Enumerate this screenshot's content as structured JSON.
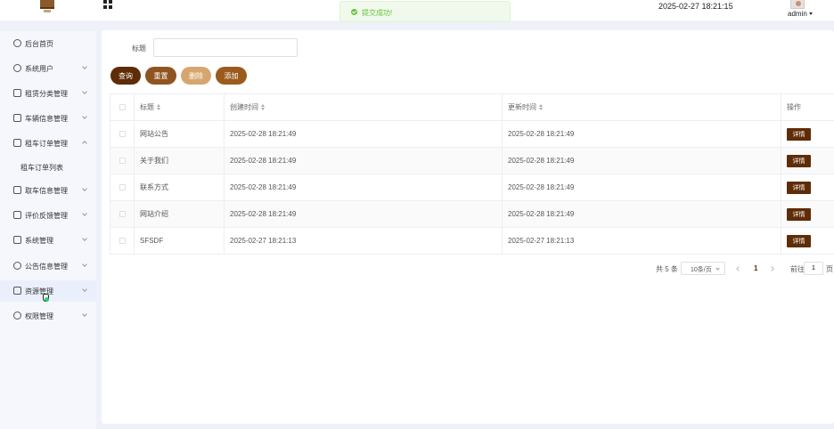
{
  "header": {
    "datetime": "2025-02-27 18:21:15",
    "username": "admin"
  },
  "toast": {
    "message": "提交成功!"
  },
  "sidebar": {
    "items": [
      {
        "label": "后台首页",
        "icon": "clock-icon"
      },
      {
        "label": "系统用户",
        "icon": "user-icon"
      },
      {
        "label": "租赁分类管理",
        "icon": "card-icon"
      },
      {
        "label": "车辆信息管理",
        "icon": "card-icon"
      },
      {
        "label": "租车订单管理",
        "icon": "card-icon"
      },
      {
        "label": "租车订单列表"
      },
      {
        "label": "取车信息管理",
        "icon": "card-icon"
      },
      {
        "label": "评价反馈管理",
        "icon": "card-icon"
      },
      {
        "label": "系统管理",
        "icon": "folder-icon"
      },
      {
        "label": "公告信息管理",
        "icon": "bell-icon"
      },
      {
        "label": "资源管理",
        "icon": "box-icon"
      },
      {
        "label": "权限管理",
        "icon": "user-icon"
      }
    ]
  },
  "search": {
    "label": "标题",
    "value": "",
    "placeholder": ""
  },
  "buttons": {
    "query": "查询",
    "reset": "重置",
    "delete": "删除",
    "add": "添加"
  },
  "table": {
    "headers": {
      "title": "标题",
      "created": "创建时间",
      "updated": "更新时间",
      "action": "操作"
    },
    "rows": [
      {
        "title": "网站公告",
        "created": "2025-02-28 18:21:49",
        "updated": "2025-02-28 18:21:49",
        "action": "详情"
      },
      {
        "title": "关于我们",
        "created": "2025-02-28 18:21:49",
        "updated": "2025-02-28 18:21:49",
        "action": "详情"
      },
      {
        "title": "联系方式",
        "created": "2025-02-28 18:21:49",
        "updated": "2025-02-28 18:21:49",
        "action": "详情"
      },
      {
        "title": "网站介绍",
        "created": "2025-02-28 18:21:49",
        "updated": "2025-02-28 18:21:49",
        "action": "详情"
      },
      {
        "title": "SFSDF",
        "created": "2025-02-27 18:21:13",
        "updated": "2025-02-27 18:21:13",
        "action": "详情"
      }
    ]
  },
  "pagination": {
    "total": "共 5 条",
    "page_size": "10条/页",
    "current_page": "1",
    "goto_label": "前往",
    "goto_value": "1",
    "page_suffix": "页"
  },
  "colors": {
    "primary": "#5e2c06",
    "reset": "#8f5520",
    "delete": "#d7a66f",
    "add": "#9b5b1e",
    "success": "#67c23a"
  }
}
